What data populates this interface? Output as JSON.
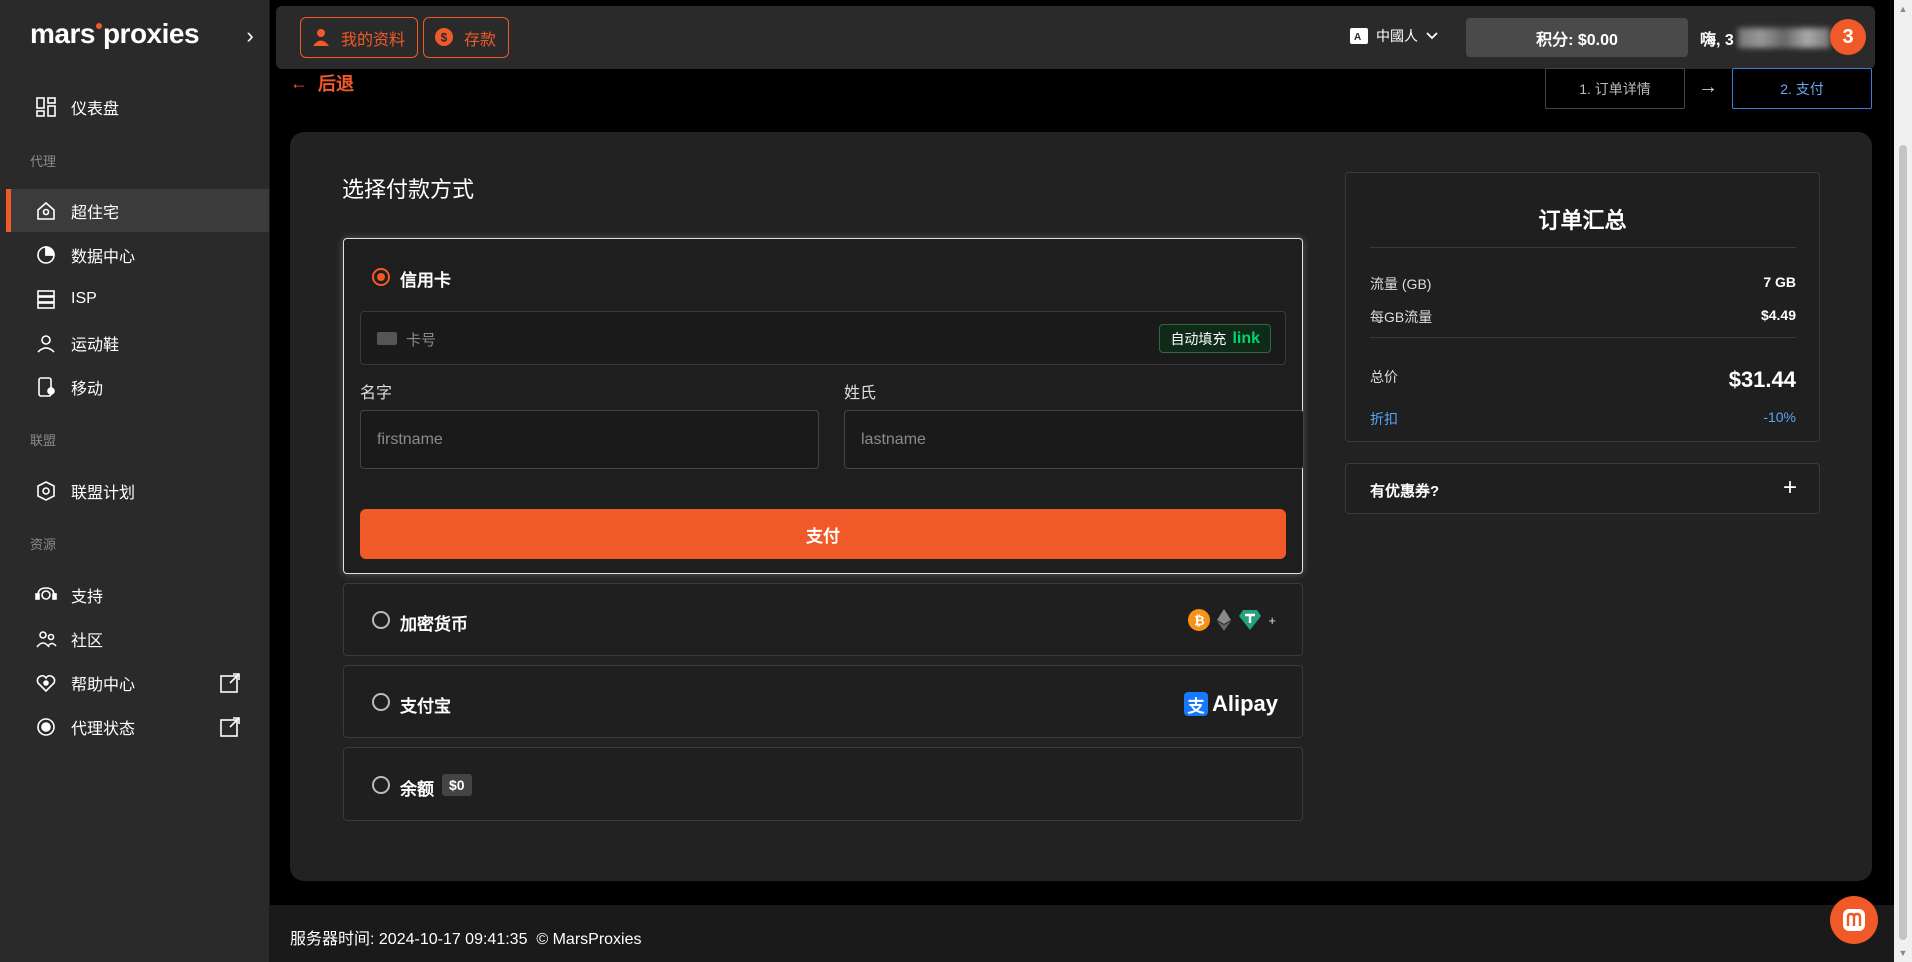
{
  "brand": {
    "logo_left": "mars",
    "logo_right": "proxies",
    "accent": "#f05a28"
  },
  "sidebar": {
    "items": [
      {
        "label": "仪表盘",
        "icon": "dashboard-icon"
      },
      {
        "label": "超住宅",
        "icon": "residential-icon",
        "active": true
      },
      {
        "label": "数据中心",
        "icon": "datacenter-icon"
      },
      {
        "label": "ISP",
        "icon": "isp-icon"
      },
      {
        "label": "运动鞋",
        "icon": "sneaker-icon"
      },
      {
        "label": "移动",
        "icon": "mobile-icon"
      },
      {
        "label": "联盟计划",
        "icon": "affiliate-icon"
      },
      {
        "label": "支持",
        "icon": "support-icon"
      },
      {
        "label": "社区",
        "icon": "community-icon"
      },
      {
        "label": "帮助中心",
        "icon": "help-center-icon"
      },
      {
        "label": "代理状态",
        "icon": "proxy-status-icon"
      }
    ],
    "sections": {
      "proxy": "代理",
      "affiliate": "联盟",
      "resources": "资源"
    }
  },
  "header": {
    "profile_btn": "我的资料",
    "deposit_btn": "存款",
    "language": "中國人",
    "credits": "积分: $0.00",
    "greeting": "嗨, 3",
    "avatar_badge": "3"
  },
  "nav": {
    "back": "后退",
    "step1": "1. 订单详情",
    "step2": "2. 支付"
  },
  "payment": {
    "title": "选择付款方式",
    "credit_card": "信用卡",
    "card_number_placeholder": "卡号",
    "autofill": "自动填充",
    "link": "link",
    "first_name_label": "名字",
    "first_name_placeholder": "firstname",
    "last_name_label": "姓氏",
    "last_name_placeholder": "lastname",
    "pay_btn": "支付",
    "crypto": "加密货币",
    "crypto_more": "+",
    "alipay": "支付宝",
    "alipay_brand": "Alipay",
    "alipay_glyph": "支",
    "balance": "余额",
    "balance_value": "$0"
  },
  "summary": {
    "title": "订单汇总",
    "traffic_label": "流量 (GB)",
    "traffic_value": "7 GB",
    "per_gb_label": "每GB流量",
    "per_gb_value": "$4.49",
    "total_label": "总价",
    "total_value": "$31.44",
    "discount_label": "折扣",
    "discount_value": "-10%",
    "coupon_label": "有优惠券?"
  },
  "footer": {
    "server_time": "服务器时间: 2024-10-17 09:41:35",
    "copyright": "© MarsProxies"
  }
}
